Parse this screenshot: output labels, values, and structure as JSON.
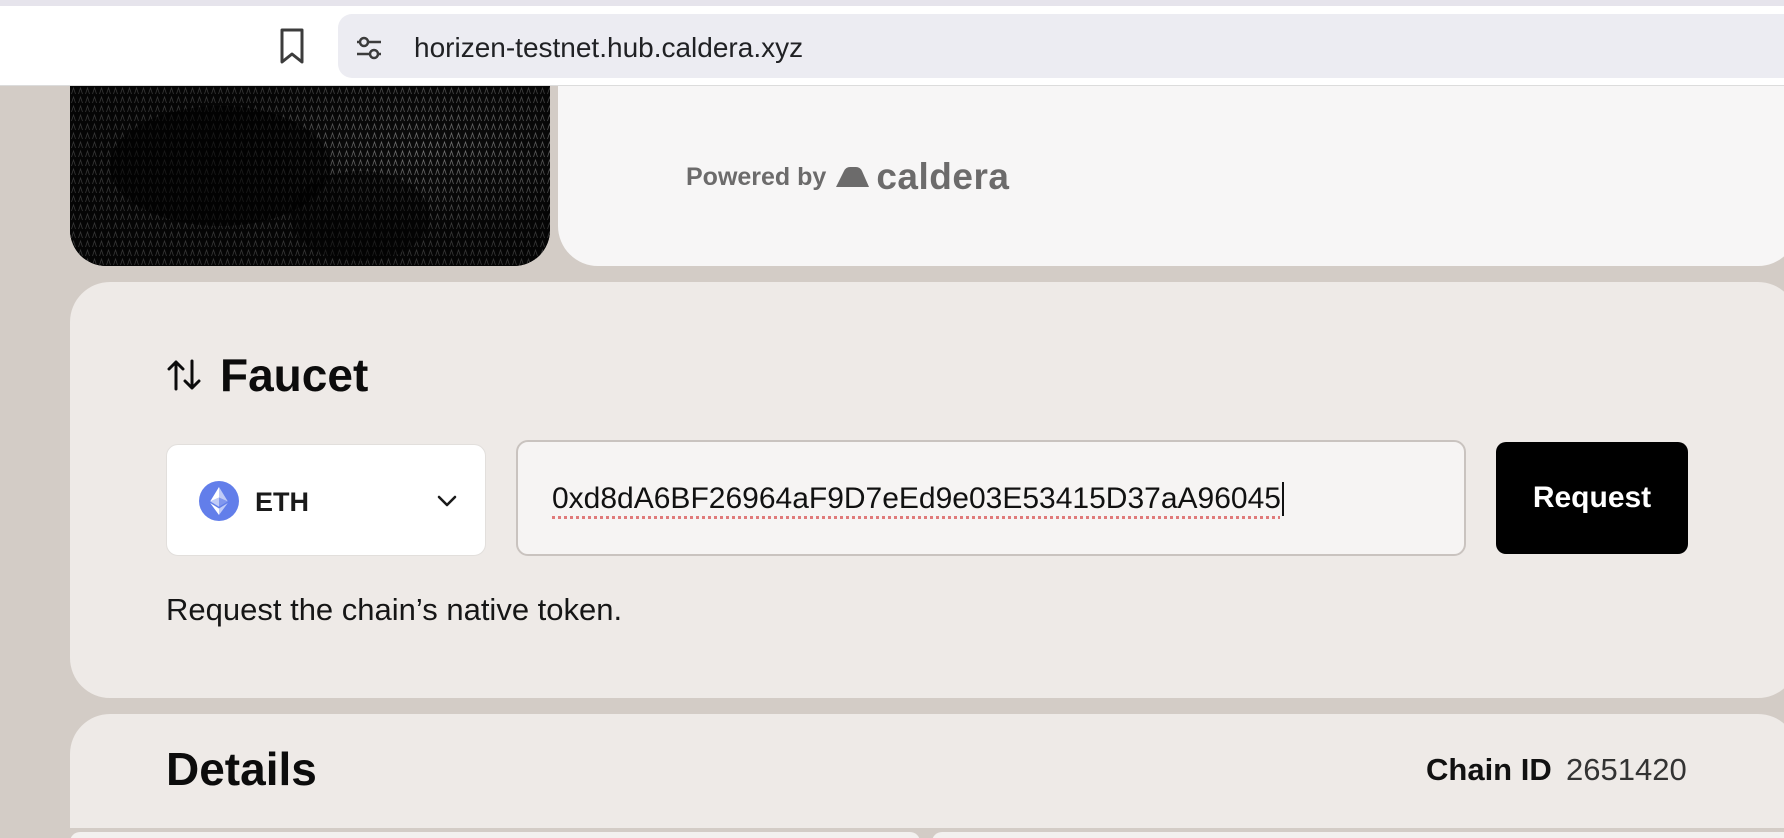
{
  "browser": {
    "url": "horizen-testnet.hub.caldera.xyz",
    "icons": {
      "bookmark": "bookmark-icon",
      "site_settings": "tune-icon"
    }
  },
  "hero": {
    "powered_by_label": "Powered by",
    "brand_name": "caldera"
  },
  "faucet": {
    "title": "Faucet",
    "title_icon": "swap-vertical-icon",
    "token": {
      "symbol": "ETH",
      "icon": "ethereum-icon"
    },
    "address_value": "0xd8dA6BF26964aF9D7eEd9e03E53415D37aA96045",
    "request_label": "Request",
    "helper_text": "Request the chain’s native token."
  },
  "details": {
    "title": "Details",
    "chain_id_label": "Chain ID",
    "chain_id_value": "2651420"
  },
  "colors": {
    "page_background": "#d3ccc6",
    "card_background": "#eeeae7",
    "button_background": "#000000",
    "ethereum": "#627eea"
  }
}
